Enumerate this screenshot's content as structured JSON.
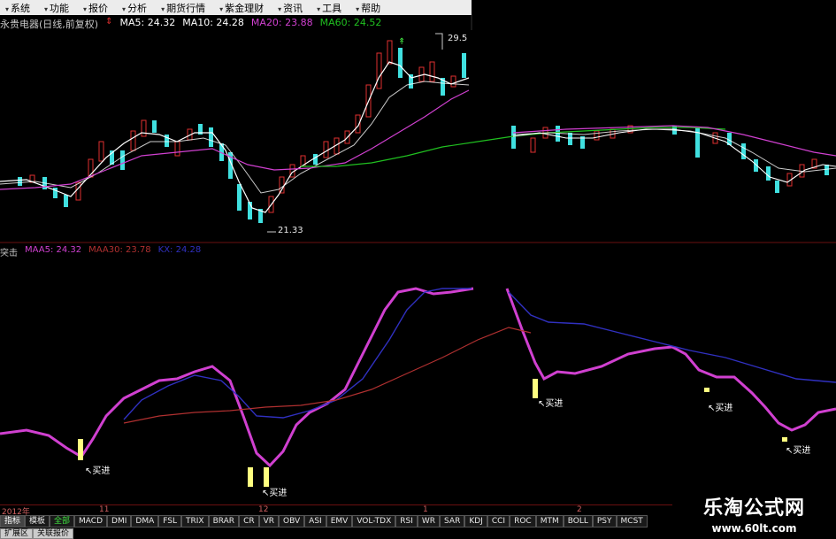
{
  "menu": [
    "系统",
    "功能",
    "报价",
    "分析",
    "期货行情",
    "紫金理财",
    "资讯",
    "工具",
    "帮助"
  ],
  "info": {
    "stock_title": "永贵电器(日线,前复权)",
    "ma5": "MA5: 24.32",
    "ma10": "MA10: 24.28",
    "ma20": "MA20: 23.88",
    "ma60": "MA60: 24.52"
  },
  "price_labels": {
    "high": "29.5",
    "low": "21.33"
  },
  "indicator": {
    "name": "突击",
    "maa5": "MAA5: 24.32",
    "maa30": "MAA30: 23.78",
    "kx": "KX: 24.28"
  },
  "buy_signal": "买进",
  "timeline": {
    "year": "2012年",
    "m11": "11",
    "m12": "12",
    "m1": "1",
    "m2": "2"
  },
  "tabs_row1": [
    "指标",
    "模板",
    "全部",
    "MACD",
    "DMI",
    "DMA",
    "FSL",
    "TRIX",
    "BRAR",
    "CR",
    "VR",
    "OBV",
    "ASI",
    "EMV",
    "VOL-TDX",
    "RSI",
    "WR",
    "SAR",
    "KDJ",
    "CCI",
    "ROC",
    "MTM",
    "BOLL",
    "PSY",
    "MCST"
  ],
  "tabs_row2": [
    "扩展区",
    "关联报价"
  ],
  "watermark": {
    "line1": "乐淘公式网",
    "line2": "www.60lt.com"
  },
  "colors": {
    "up": "#e03030",
    "down": "#40e0e0",
    "ma20": "#d040d0",
    "ma60": "#20c020",
    "maa5": "#d040d0",
    "maa30": "#b03030",
    "kx": "#3030c0",
    "signal": "#ffff80"
  }
}
